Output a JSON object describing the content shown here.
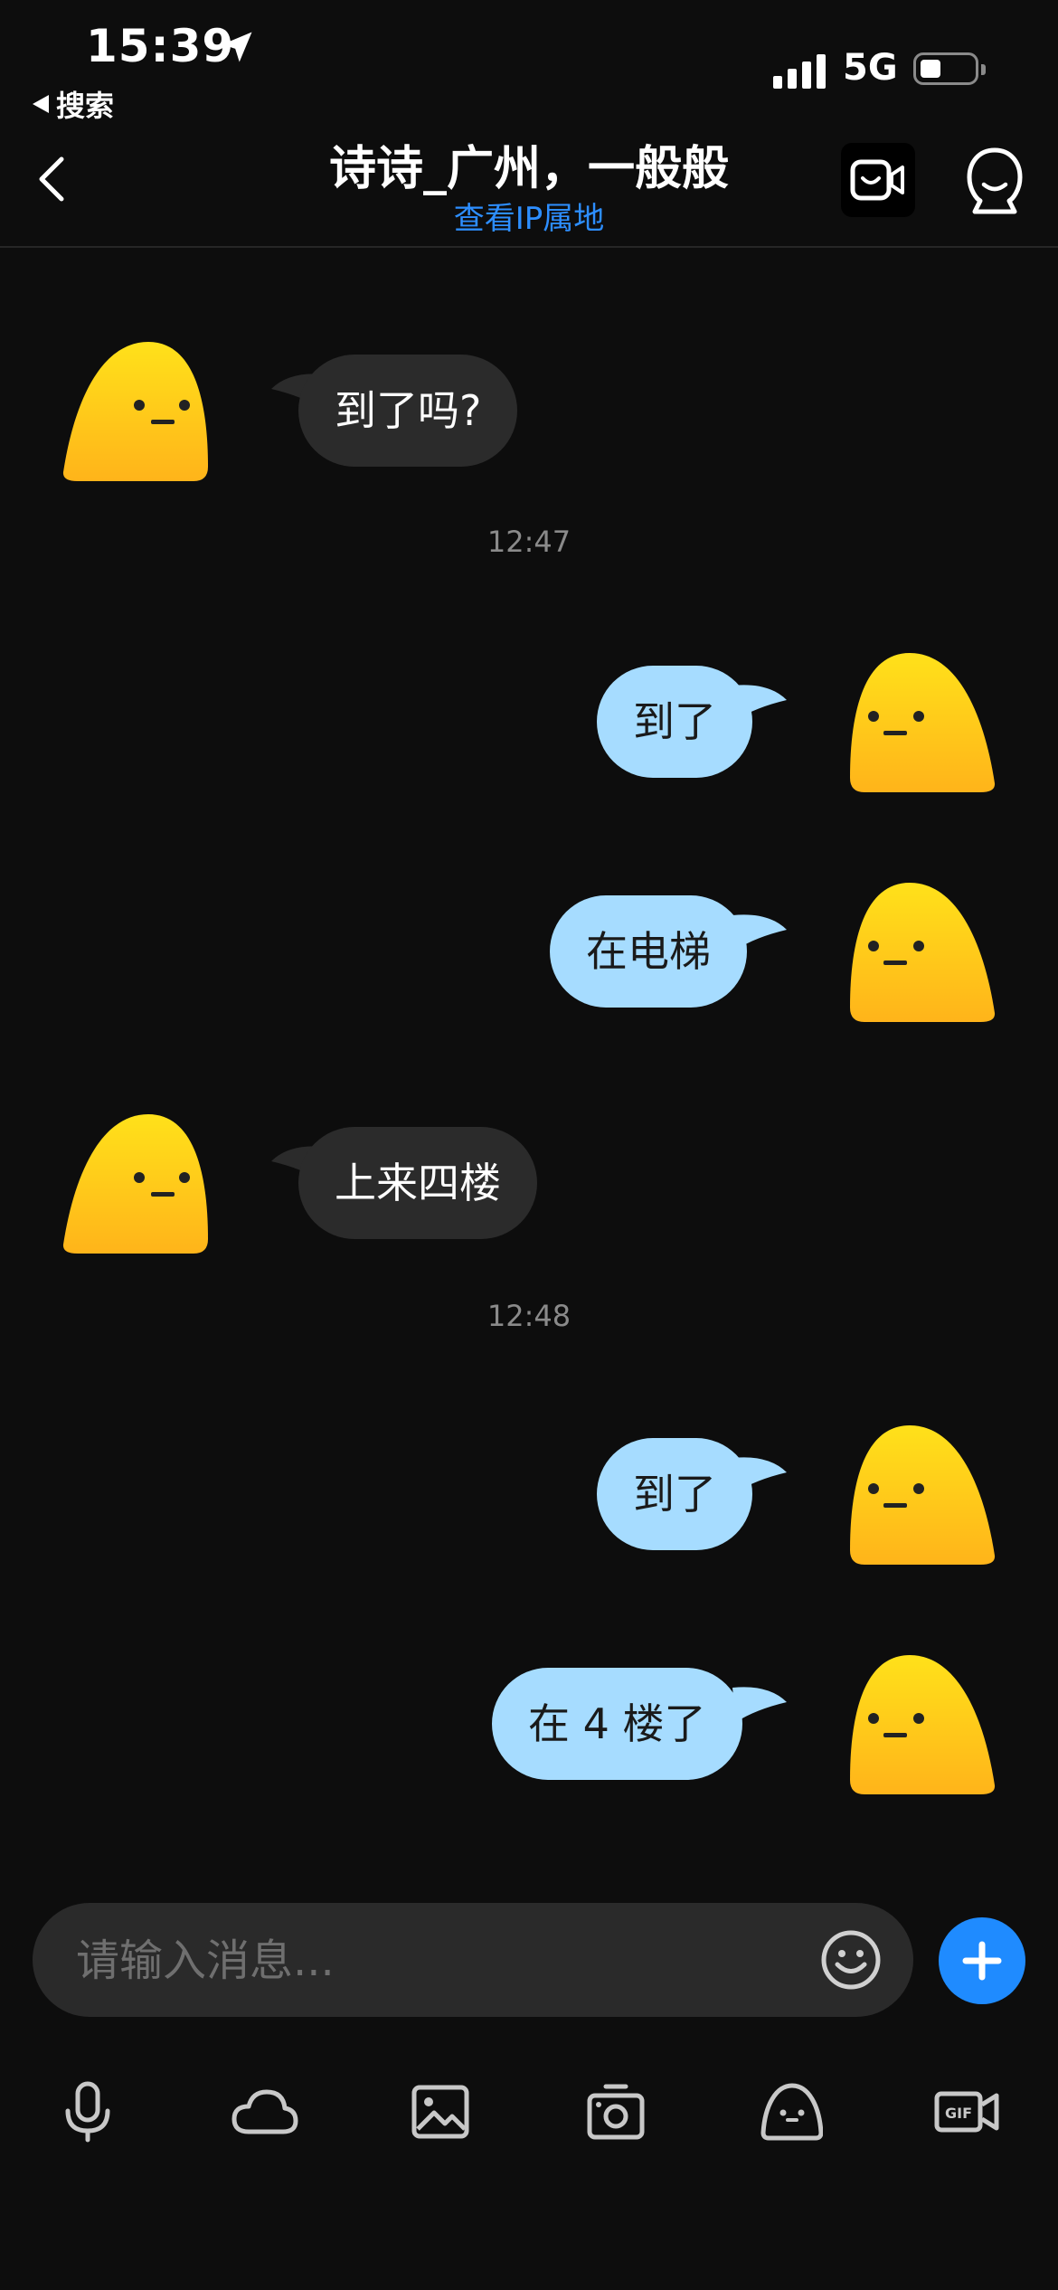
{
  "status_bar": {
    "time": "15:39",
    "back_app_label": "搜索",
    "network": "5G"
  },
  "header": {
    "title": "诗诗_广州，一般般",
    "subtitle": "查看IP属地"
  },
  "messages": [
    {
      "side": "in",
      "text": "到了吗?"
    },
    {
      "type": "timestamp",
      "text": "12:47"
    },
    {
      "side": "out",
      "text": "到了"
    },
    {
      "side": "out",
      "text": "在电梯"
    },
    {
      "side": "in",
      "text": "上来四楼"
    },
    {
      "type": "timestamp",
      "text": "12:48"
    },
    {
      "side": "out",
      "text": "到了"
    },
    {
      "side": "out",
      "text": "在 4 楼了"
    }
  ],
  "input": {
    "placeholder": "请输入消息..."
  },
  "toolbar": {
    "icons": [
      "microphone-icon",
      "cloud-icon",
      "image-icon",
      "camera-icon",
      "emoji-face-icon",
      "gif-icon"
    ]
  },
  "colors": {
    "background": "#0d0d0d",
    "incoming_bubble": "#2b2b2b",
    "outgoing_bubble": "#a6dcff",
    "accent": "#1f8bff",
    "avatar_yellow": "#ffd21a"
  }
}
